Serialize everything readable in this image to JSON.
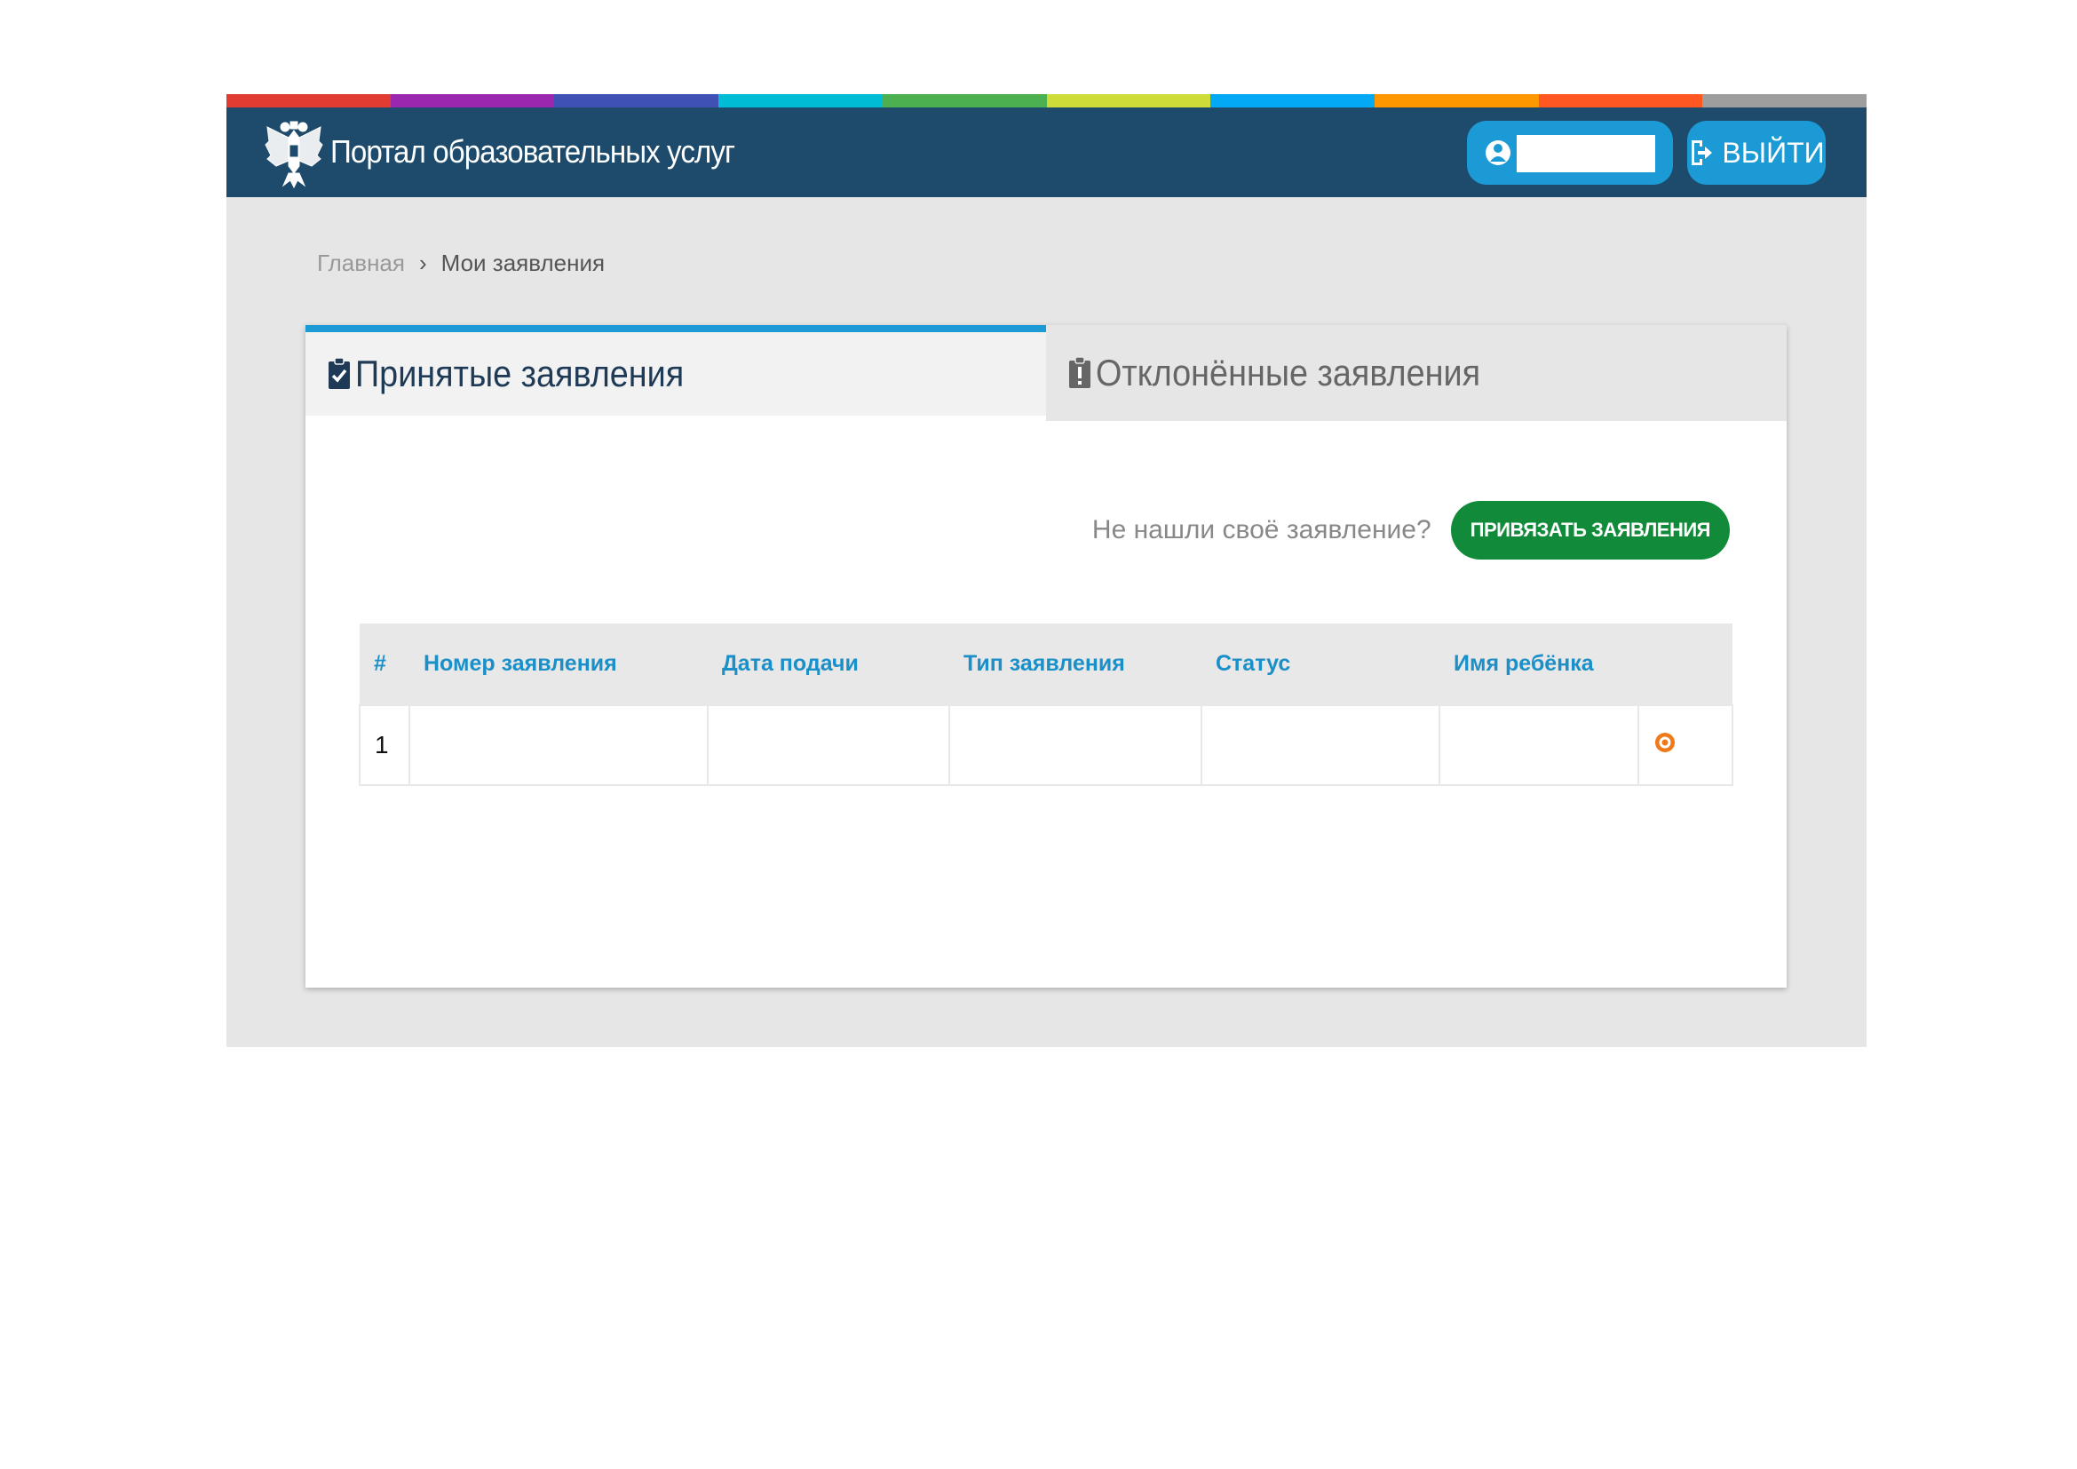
{
  "colors": {
    "header_bg": "#1e4b6b",
    "accent_blue": "#1b9ad6",
    "bind_green": "#118a3a",
    "table_header_text": "#1b8fc8",
    "status_orange": "#f07a1a",
    "stripe": [
      "#e03c31",
      "#9b27af",
      "#3f51b5",
      "#00bcd4",
      "#4caf50",
      "#cddc39",
      "#03a9f4",
      "#ff9800",
      "#ff5722",
      "#9e9e9e"
    ]
  },
  "header": {
    "title": "Портал образовательных услуг",
    "logo_icon": "coat-of-arms-icon",
    "user_icon": "user-icon",
    "user_name": "",
    "logout_label": "ВЫЙТИ",
    "logout_icon": "sign-out-icon"
  },
  "breadcrumb": {
    "home": "Главная",
    "separator": "›",
    "current": "Мои заявления"
  },
  "tabs": [
    {
      "label": "Принятые заявления",
      "icon": "clipboard-check-icon",
      "active": true
    },
    {
      "label": "Отклонённые заявления",
      "icon": "clipboard-exclamation-icon",
      "active": false
    }
  ],
  "notfound": {
    "text": "Не нашли своё заявление?",
    "button_label": "ПРИВЯЗАТЬ ЗАЯВЛЕНИЯ"
  },
  "table": {
    "columns": [
      "#",
      "Номер заявления",
      "Дата подачи",
      "Тип заявления",
      "Статус",
      "Имя ребёнка",
      ""
    ],
    "rows": [
      {
        "index": "1",
        "number": "",
        "date": "",
        "type": "",
        "status": "",
        "child": "",
        "action_icon": "circle-info-icon"
      }
    ]
  }
}
